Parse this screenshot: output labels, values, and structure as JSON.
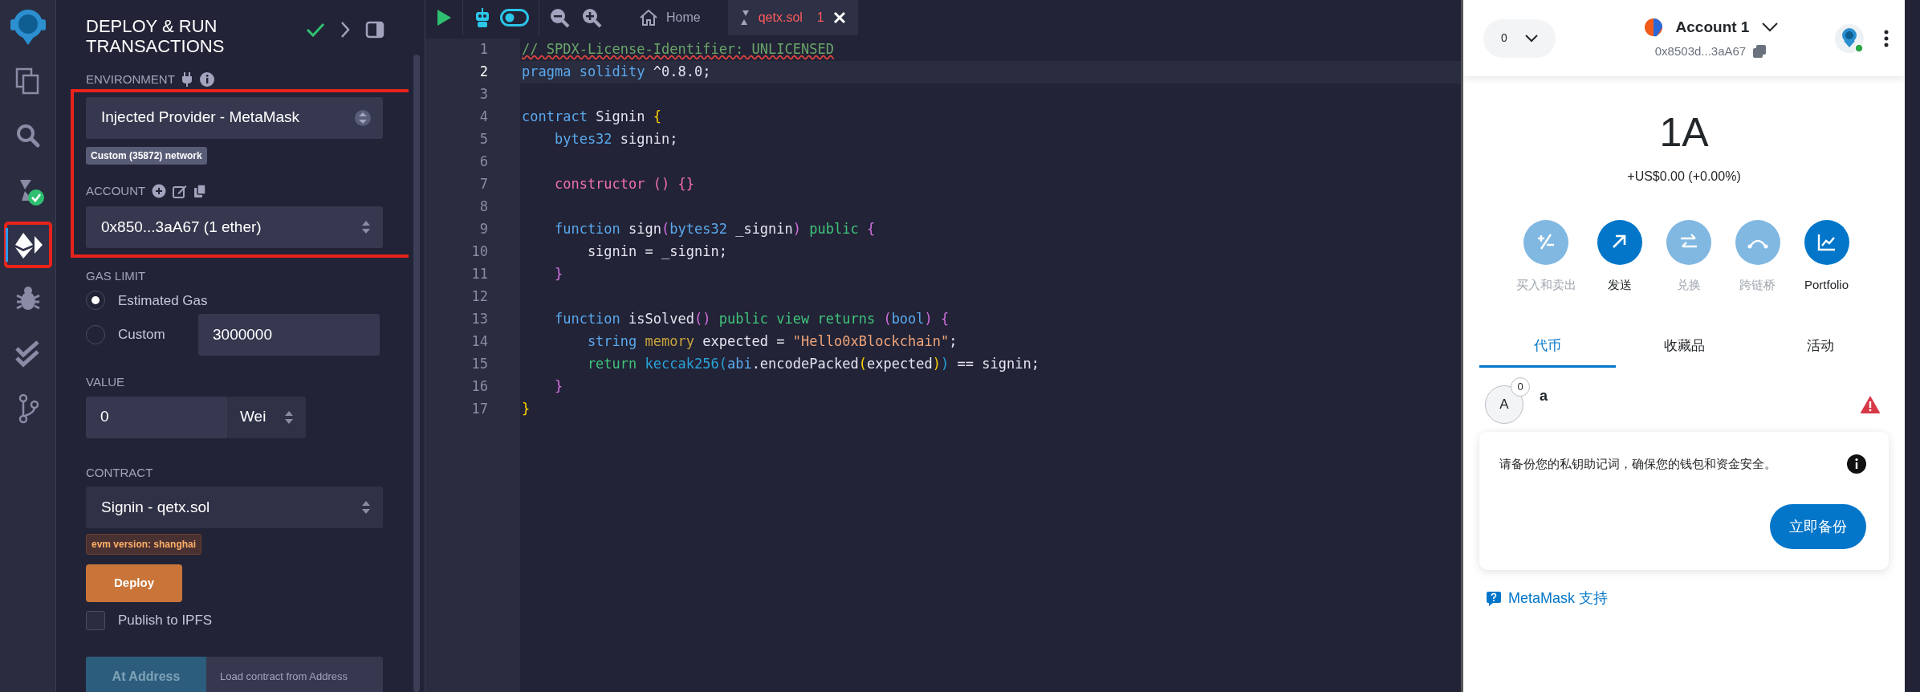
{
  "activity_bar": {
    "items": [
      {
        "kind": "logo",
        "selected": false,
        "highlighted": false
      },
      {
        "kind": "files",
        "selected": false,
        "highlighted": false
      },
      {
        "kind": "search",
        "selected": false,
        "highlighted": false
      },
      {
        "kind": "compiler",
        "selected": false,
        "highlighted": false
      },
      {
        "kind": "deploy",
        "selected": true,
        "highlighted": true
      },
      {
        "kind": "debugger",
        "selected": false,
        "highlighted": false
      },
      {
        "kind": "tests",
        "selected": false,
        "highlighted": false
      },
      {
        "kind": "git",
        "selected": false,
        "highlighted": false
      }
    ]
  },
  "panel": {
    "title": "DEPLOY & RUN TRANSACTIONS",
    "environment": {
      "label": "ENVIRONMENT",
      "value": "Injected Provider - MetaMask",
      "network_badge": "Custom (35872) network",
      "highlighted": true,
      "account_label": "ACCOUNT",
      "account": "0x850...3aA67 (1 ether)"
    },
    "gas": {
      "label": "GAS LIMIT",
      "options": [
        {
          "label": "Estimated Gas",
          "selected": true
        },
        {
          "label": "Custom",
          "selected": false,
          "value": "3000000"
        }
      ]
    },
    "value": {
      "label": "VALUE",
      "amount": "0",
      "unit": "Wei"
    },
    "contract": {
      "label": "CONTRACT",
      "value": "Signin - qetx.sol",
      "evm_badge": "evm version: shanghai"
    },
    "deploy_button": "Deploy",
    "publish": {
      "label": "Publish to IPFS",
      "checked": false
    },
    "at_address": {
      "button": "At Address",
      "disabled": true,
      "placeholder": "Load contract from Address"
    }
  },
  "editor": {
    "switch_on": true,
    "tabs": [
      {
        "kind": "home",
        "label": "Home",
        "selected": false
      },
      {
        "kind": "file",
        "label": "qetx.sol",
        "problems": "1",
        "selected": true
      }
    ],
    "lines": [
      {
        "number": "1",
        "active": false,
        "tokens": [
          {
            "kind": "comment",
            "text": "// SPDX-License-Identifier: UNLICENSED"
          }
        ]
      },
      {
        "number": "2",
        "active": true,
        "tokens": [
          {
            "kind": "keyword",
            "text": "pragma solidity"
          },
          {
            "kind": "plain",
            "text": " ^0.8.0;"
          }
        ]
      },
      {
        "number": "3",
        "active": false
      },
      {
        "number": "4",
        "active": false,
        "tokens": [
          {
            "kind": "keyword",
            "text": "contract"
          },
          {
            "kind": "plain",
            "text": " Signin "
          },
          {
            "kind": "brace",
            "text": "{"
          }
        ]
      },
      {
        "number": "5",
        "active": false,
        "tokens": [
          {
            "kind": "keyword",
            "text": "    bytes32"
          },
          {
            "kind": "plain",
            "text": " signin;"
          }
        ]
      },
      {
        "number": "6",
        "active": false
      },
      {
        "number": "7",
        "active": false,
        "tokens": [
          {
            "kind": "special",
            "text": "    constructor () {}"
          }
        ]
      },
      {
        "number": "8",
        "active": false
      },
      {
        "number": "9",
        "active": false,
        "tokens": [
          {
            "kind": "keyword",
            "text": "    function"
          },
          {
            "kind": "plain",
            "text": " sign"
          },
          {
            "kind": "paren",
            "text": "("
          },
          {
            "kind": "keyword",
            "text": "bytes32"
          },
          {
            "kind": "plain",
            "text": " _signin"
          },
          {
            "kind": "paren",
            "text": ")"
          },
          {
            "kind": "modifier",
            "text": " public"
          },
          {
            "kind": "paren",
            "text": " {"
          }
        ]
      },
      {
        "number": "10",
        "active": false,
        "tokens": [
          {
            "kind": "plain",
            "text": "        signin = _signin;"
          }
        ]
      },
      {
        "number": "11",
        "active": false,
        "tokens": [
          {
            "kind": "paren",
            "text": "    }"
          }
        ]
      },
      {
        "number": "12",
        "active": false
      },
      {
        "number": "13",
        "active": false,
        "tokens": [
          {
            "kind": "keyword",
            "text": "    function"
          },
          {
            "kind": "plain",
            "text": " isSolved"
          },
          {
            "kind": "paren",
            "text": "()"
          },
          {
            "kind": "modifier",
            "text": " public view returns"
          },
          {
            "kind": "paren",
            "text": " ("
          },
          {
            "kind": "keyword",
            "text": "bool"
          },
          {
            "kind": "paren",
            "text": ")"
          },
          {
            "kind": "paren",
            "text": " {"
          }
        ]
      },
      {
        "number": "14",
        "active": false,
        "tokens": [
          {
            "kind": "keyword",
            "text": "        string"
          },
          {
            "kind": "storage",
            "text": " memory"
          },
          {
            "kind": "plain",
            "text": " expected = "
          },
          {
            "kind": "string",
            "text": "\"Hello0xBlockchain\""
          },
          {
            "kind": "plain",
            "text": ";"
          }
        ]
      },
      {
        "number": "15",
        "active": false,
        "tokens": [
          {
            "kind": "modifier",
            "text": "        return"
          },
          {
            "kind": "builtin",
            "text": " keccak256"
          },
          {
            "kind": "builtin",
            "text": "("
          },
          {
            "kind": "keyword",
            "text": "abi"
          },
          {
            "kind": "plain",
            "text": ".encodePacked"
          },
          {
            "kind": "brace",
            "text": "("
          },
          {
            "kind": "plain",
            "text": "expected"
          },
          {
            "kind": "brace",
            "text": ")"
          },
          {
            "kind": "builtin",
            "text": ")"
          },
          {
            "kind": "plain",
            "text": " == signin;"
          }
        ]
      },
      {
        "number": "16",
        "active": false,
        "tokens": [
          {
            "kind": "paren",
            "text": "    }"
          }
        ]
      },
      {
        "number": "17",
        "active": false,
        "tokens": [
          {
            "kind": "brace",
            "text": "}"
          }
        ]
      }
    ]
  },
  "wallet": {
    "network": "0",
    "account_name": "Account 1",
    "address": "0x8503d...3aA67",
    "connected": true,
    "balance": "1A",
    "change": "+US$0.00 (+0.00%)",
    "actions": [
      {
        "kind": "buy-sell",
        "label": "买入和卖出",
        "disabled": true
      },
      {
        "kind": "send",
        "label": "发送",
        "disabled": false
      },
      {
        "kind": "swap",
        "label": "兑换",
        "disabled": true
      },
      {
        "kind": "bridge",
        "label": "跨链桥",
        "disabled": true
      },
      {
        "kind": "portfolio",
        "label": "Portfolio",
        "disabled": false
      }
    ],
    "tabs": [
      {
        "label": "代币",
        "selected": true
      },
      {
        "label": "收藏品",
        "selected": false
      },
      {
        "label": "活动",
        "selected": false
      }
    ],
    "tokens": [
      {
        "avatar": "A",
        "badge": "0",
        "name": "a",
        "warning": true
      }
    ],
    "notice": {
      "text": "请备份您的私钥助记词，确保您的钱包和资金安全。",
      "button": "立即备份"
    },
    "support_link": "MetaMask 支持"
  }
}
